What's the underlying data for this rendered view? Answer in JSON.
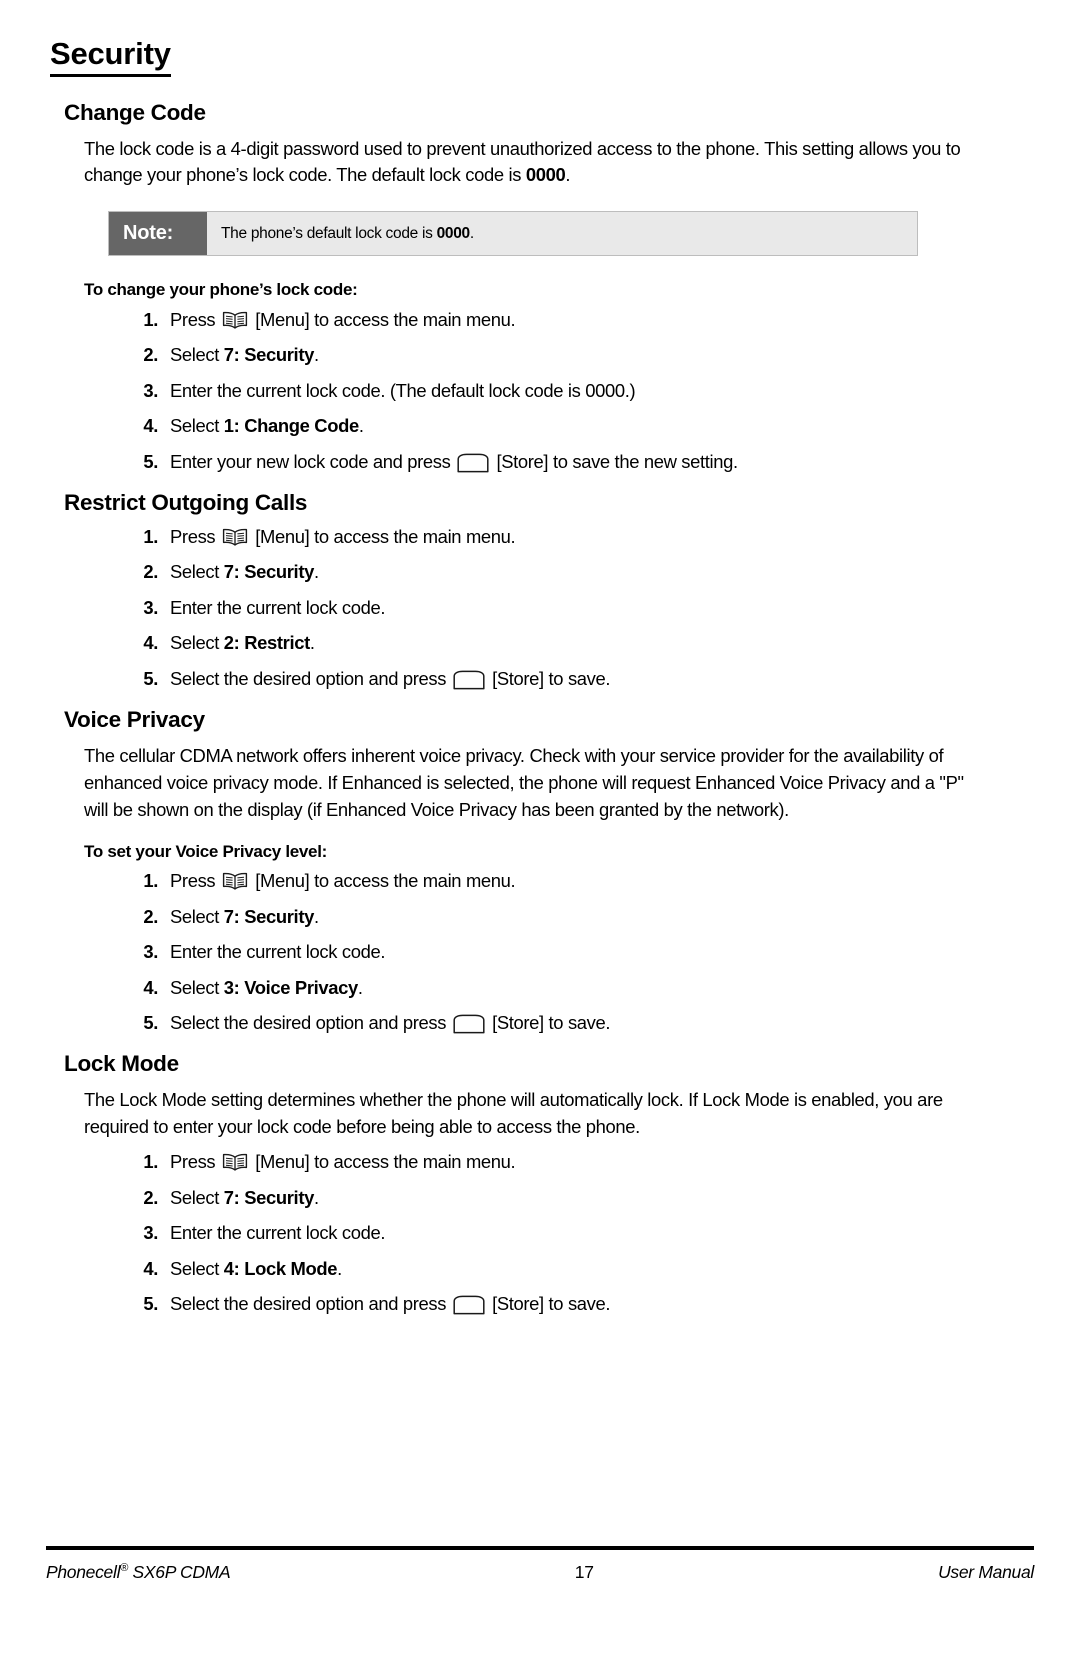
{
  "page_title": "Security",
  "sections": [
    {
      "heading": "Change Code",
      "paragraphs": [
        "The lock code is a 4-digit password used to prevent unauthorized access to the phone. This setting allows you to change your phone’s lock code. The default lock code is 0000."
      ]
    },
    {
      "heading": "Restrict Outgoing Calls"
    },
    {
      "heading": "Voice Privacy",
      "paragraphs": [
        "The cellular CDMA network offers inherent voice privacy. Check with your service provider for the availability of enhanced voice privacy mode. If Enhanced is selected, the phone will request Enhanced Voice Privacy and a \"P\" will be shown on the display (if Enhanced Voice Privacy has been granted by the network)."
      ]
    },
    {
      "heading": "Lock Mode",
      "paragraphs": [
        "The Lock Mode setting determines whether the phone will automatically lock. If Lock Mode is enabled, you are required to enter your lock code before being able to access the phone."
      ]
    }
  ],
  "note": {
    "label": "Note:",
    "text_before_bold": "The phone’s default lock code is ",
    "bold_value": "0000",
    "text_after_bold": ".",
    "label_bg": "#666666",
    "body_bg": "#e9e9e9",
    "border_color": "#bdbdbd"
  },
  "change_code": {
    "intro_bold": "To change your phone’s lock code:",
    "intro_before_bold": "The lock code is a 4-digit password used to prevent unauthorized access to the phone. This setting allows you to change your phone’s lock code. The default lock code is ",
    "intro_bold_value": "0000",
    "intro_after_bold": ".",
    "steps": [
      {
        "num": "1.",
        "pre": "Press",
        "icon": "menu-icon",
        "post": "[Menu] to access the main menu."
      },
      {
        "num": "2.",
        "pre": "Select ",
        "bold": "7: Security",
        "post": "."
      },
      {
        "num": "3.",
        "pre": "Enter the current lock code. (The default lock code is 0000.)"
      },
      {
        "num": "4.",
        "pre": "Select ",
        "bold": "1: Change Code",
        "post": "."
      },
      {
        "num": "5.",
        "pre": "Enter your new lock code and press",
        "icon": "store-icon",
        "post": "[Store] to save the new setting."
      }
    ]
  },
  "restrict": {
    "steps": [
      {
        "num": "1.",
        "pre": "Press",
        "icon": "menu-icon",
        "post": "[Menu] to access the main menu."
      },
      {
        "num": "2.",
        "pre": "Select ",
        "bold": "7: Security",
        "post": "."
      },
      {
        "num": "3.",
        "pre": "Enter the current lock code."
      },
      {
        "num": "4.",
        "pre": "Select ",
        "bold": "2: Restrict",
        "post": "."
      },
      {
        "num": "5.",
        "pre": "Select the desired option and press",
        "icon": "store-icon",
        "post": "[Store] to save."
      }
    ]
  },
  "voice_privacy": {
    "intro_bold": "To set your Voice Privacy level:",
    "steps": [
      {
        "num": "1.",
        "pre": "Press",
        "icon": "menu-icon",
        "post": "[Menu] to access the main menu."
      },
      {
        "num": "2.",
        "pre": "Select ",
        "bold": "7: Security",
        "post": "."
      },
      {
        "num": "3.",
        "pre": "Enter the current lock code."
      },
      {
        "num": "4.",
        "pre": "Select ",
        "bold": "3: Voice Privacy",
        "post": "."
      },
      {
        "num": "5.",
        "pre": "Select the desired option and press",
        "icon": "store-icon",
        "post": "[Store] to save."
      }
    ]
  },
  "lock_mode": {
    "steps": [
      {
        "num": "1.",
        "pre": "Press",
        "icon": "menu-icon",
        "post": "[Menu] to access the main menu."
      },
      {
        "num": "2.",
        "pre": "Select ",
        "bold": "7: Security",
        "post": "."
      },
      {
        "num": "3.",
        "pre": "Enter the current lock code."
      },
      {
        "num": "4.",
        "pre": "Select ",
        "bold": "4: Lock Mode",
        "post": "."
      },
      {
        "num": "5.",
        "pre": "Select the desired option and press",
        "icon": "store-icon",
        "post": "[Store] to save."
      }
    ]
  },
  "footer": {
    "left_text": "Phonecell",
    "left_sup": "®",
    "left_text2": " SX6P CDMA",
    "page_number": "17",
    "right_text": "User Manual"
  }
}
